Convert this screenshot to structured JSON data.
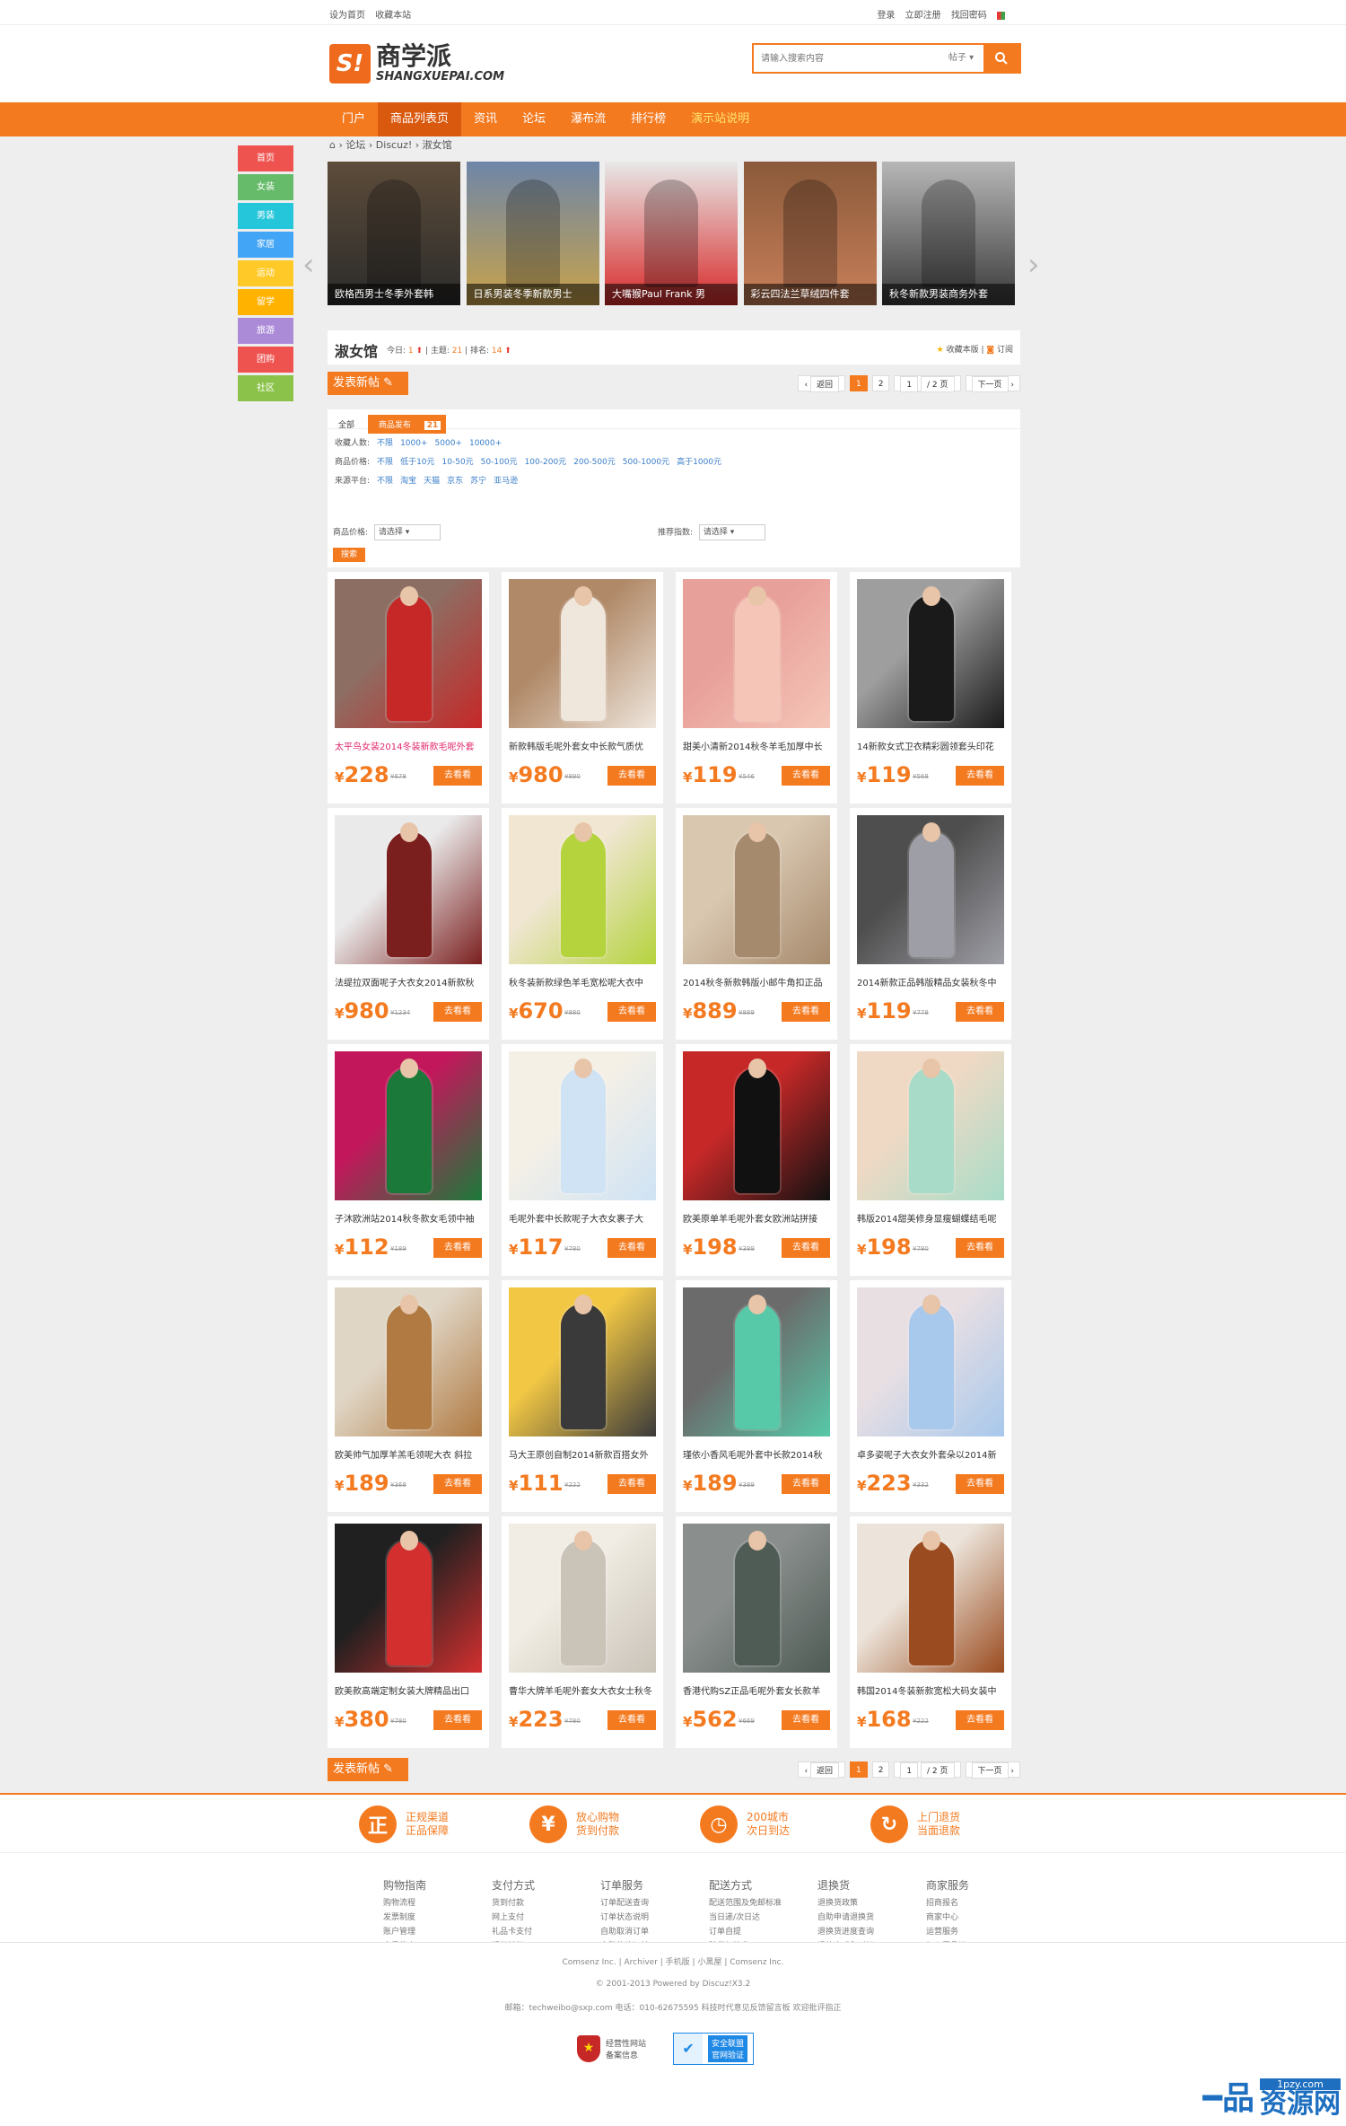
{
  "topbar": {
    "set_home": "设为首页",
    "favorite": "收藏本站",
    "login": "登录",
    "register": "立即注册",
    "forgot": "找回密码"
  },
  "logo": {
    "mark": "S!",
    "name": "商学派",
    "domain": "SHANGXUEPAI.COM"
  },
  "search": {
    "placeholder": "请输入搜索内容",
    "scope": "帖子"
  },
  "nav": [
    "门户",
    "商品列表页",
    "资讯",
    "论坛",
    "瀑布流",
    "排行榜",
    "演示站说明"
  ],
  "leftnav": [
    {
      "label": "首页",
      "color": "#ef5350"
    },
    {
      "label": "女装",
      "color": "#66bb6a"
    },
    {
      "label": "男装",
      "color": "#26c6da"
    },
    {
      "label": "家居",
      "color": "#42a5f5"
    },
    {
      "label": "运动",
      "color": "#ffca28"
    },
    {
      "label": "留学",
      "color": "#ffb300"
    },
    {
      "label": "旅游",
      "color": "#ab8bd8"
    },
    {
      "label": "团购",
      "color": "#ef5350"
    },
    {
      "label": "社区",
      "color": "#8bc34a"
    }
  ],
  "breadcrumb": [
    "论坛",
    "Discuz!",
    "淑女馆"
  ],
  "slider": [
    "欧格西男士冬季外套韩",
    "日系男装冬季新款男士",
    "大嘴猴Paul Frank 男",
    "彩云四法兰草绒四件套",
    "秋冬新款男装商务外套"
  ],
  "forum": {
    "name": "淑女馆",
    "today_label": "今日:",
    "today": "1",
    "topics_label": "主题:",
    "topics": "21",
    "rank_label": "排名:",
    "rank": "14",
    "fav": "收藏本版",
    "sub": "订阅"
  },
  "post_button": "发表新帖",
  "pager": {
    "back": "返回",
    "pages": [
      "1",
      "2"
    ],
    "current": "1",
    "input": "1",
    "total": "/ 2 页",
    "next": "下一页"
  },
  "filter": {
    "tabs": [
      "全部",
      "商品发布"
    ],
    "tab_count": "21",
    "rows": [
      {
        "label": "收藏人数:",
        "values": [
          "不限",
          "1000+",
          "5000+",
          "10000+"
        ]
      },
      {
        "label": "商品价格:",
        "values": [
          "不限",
          "低于10元",
          "10-50元",
          "50-100元",
          "100-200元",
          "200-500元",
          "500-1000元",
          "高于1000元"
        ]
      },
      {
        "label": "来源平台:",
        "values": [
          "不限",
          "淘宝",
          "天猫",
          "京东",
          "苏宁",
          "亚马逊"
        ]
      }
    ],
    "price_label": "商品价格:",
    "price_select": "请选择",
    "recommend_label": "推荐指数:",
    "recommend_select": "请选择",
    "search_btn": "搜索"
  },
  "go_label": "去看看",
  "currency": "¥",
  "products": [
    {
      "title": "太平鸟女装2014冬装新款毛呢外套",
      "price": "228",
      "orig": "¥678",
      "hl": true
    },
    {
      "title": "新款韩版毛呢外套女中长款气质优",
      "price": "980",
      "orig": "¥890"
    },
    {
      "title": "甜美小清新2014秋冬羊毛加厚中长",
      "price": "119",
      "orig": "¥546"
    },
    {
      "title": "14新款女式卫衣精彩圆领套头印花",
      "price": "119",
      "orig": "¥568"
    },
    {
      "title": "法缇拉双面呢子大衣女2014新款秋",
      "price": "980",
      "orig": "¥1234"
    },
    {
      "title": "秋冬装新款绿色羊毛宽松呢大衣中",
      "price": "670",
      "orig": "¥880"
    },
    {
      "title": "2014秋冬新款韩版小邮牛角扣正品",
      "price": "889",
      "orig": "¥889"
    },
    {
      "title": "2014新款正品韩版精品女装秋冬中",
      "price": "119",
      "orig": "¥778"
    },
    {
      "title": "子沐欧洲站2014秋冬款女毛领中袖",
      "price": "112",
      "orig": "¥189"
    },
    {
      "title": "毛呢外套中长款呢子大衣女裹子大",
      "price": "117",
      "orig": "¥780"
    },
    {
      "title": "欧美原单羊毛呢外套女欧洲站拼接",
      "price": "198",
      "orig": "¥389"
    },
    {
      "title": "韩版2014甜美修身显瘦蝴蝶结毛呢",
      "price": "198",
      "orig": "¥780"
    },
    {
      "title": "欧美帅气加厚羊羔毛领呢大衣 斜拉",
      "price": "189",
      "orig": "¥368"
    },
    {
      "title": "马大王原创自制2014新款百搭女外",
      "price": "111",
      "orig": "¥222"
    },
    {
      "title": "瑾依小香风毛呢外套中长款2014秋",
      "price": "189",
      "orig": "¥389"
    },
    {
      "title": "卓多姿呢子大衣女外套朵以2014新",
      "price": "223",
      "orig": "¥332"
    },
    {
      "title": "欧美款高端定制女装大牌精品出口",
      "price": "380",
      "orig": "¥780"
    },
    {
      "title": "曹华大牌羊毛呢外套女大衣女士秋冬",
      "price": "223",
      "orig": "¥780"
    },
    {
      "title": "香港代购SZ正品毛呢外套女长款羊",
      "price": "562",
      "orig": "¥669"
    },
    {
      "title": "韩国2014冬装新款宽松大码女装中",
      "price": "168",
      "orig": "¥222"
    }
  ],
  "features": [
    {
      "icon": "正",
      "l1": "正规渠道",
      "l2": "正品保障"
    },
    {
      "icon": "¥",
      "l1": "放心购物",
      "l2": "货到付款"
    },
    {
      "icon": "◷",
      "l1": "200城市",
      "l2": "次日到达"
    },
    {
      "icon": "↻",
      "l1": "上门退货",
      "l2": "当面退款"
    }
  ],
  "footer_cols": [
    {
      "h": "购物指南",
      "items": [
        "购物流程",
        "发票制度",
        "账户管理",
        "会员优惠"
      ]
    },
    {
      "h": "支付方式",
      "items": [
        "货到付款",
        "网上支付",
        "礼品卡支付",
        "银行转帐"
      ]
    },
    {
      "h": "订单服务",
      "items": [
        "订单配送查询",
        "订单状态说明",
        "自助取消订单",
        "自助修改订单"
      ]
    },
    {
      "h": "配送方式",
      "items": [
        "配送范围及免邮标准",
        "当日递/次日达",
        "订单自提",
        "验货与签收"
      ]
    },
    {
      "h": "退换货",
      "items": [
        "退换货政策",
        "自助申请退换货",
        "退换货进度查询",
        "退款方式和时间"
      ]
    },
    {
      "h": "商家服务",
      "items": [
        "招商报名",
        "商家中心",
        "运营服务",
        "加入尾品汇"
      ]
    }
  ],
  "footer": {
    "links": [
      "Comsenz Inc.",
      "Archiver",
      "手机版",
      "小黑屋",
      "Comsenz Inc."
    ],
    "copyright": "© 2001-2013 Powered by Discuz!X3.2",
    "contact": "邮箱：techweibo@sxp.com 电话：010-62675595 科技时代意见反馈留言板 欢迎批评指正",
    "badge1_l1": "经营性网站",
    "badge1_l2": "备案信息",
    "badge2_l1": "安全联盟",
    "badge2_l2": "官网验证"
  },
  "watermark": {
    "domain": "1pzy.com",
    "text": "资源网"
  }
}
